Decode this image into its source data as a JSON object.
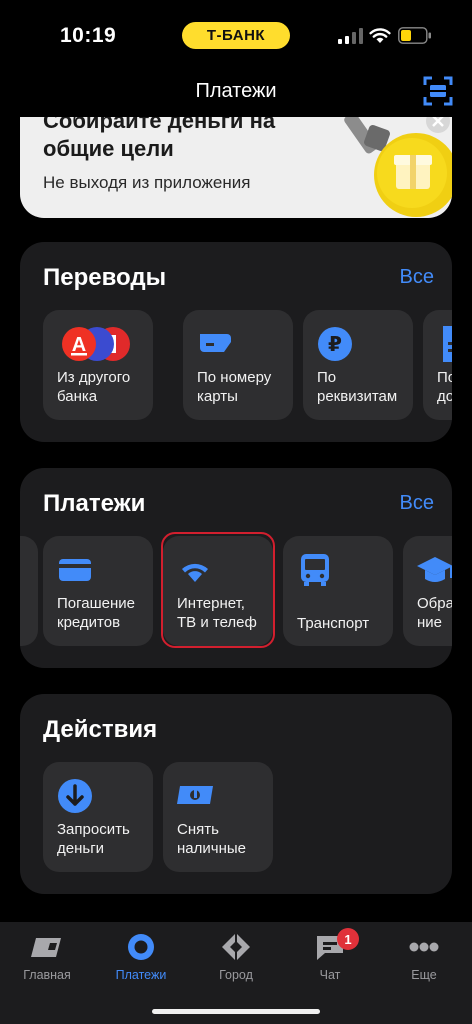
{
  "status_bar": {
    "time": "10:19",
    "bank_badge": "Т-БАНК"
  },
  "header": {
    "title": "Платежи"
  },
  "promo": {
    "title": "Собирайте деньги на общие цели",
    "subtitle": "Не выходя из приложения"
  },
  "transfers": {
    "title": "Переводы",
    "all_label": "Все",
    "items": [
      {
        "label": "Из другого\nбанка",
        "icon": "bank-logos-icon"
      },
      {
        "label": "По номеру\nкарты",
        "icon": "card-icon"
      },
      {
        "label": "По\nреквизитам",
        "icon": "ruble-icon"
      },
      {
        "label": "По но\nдогово",
        "icon": "document-icon"
      }
    ]
  },
  "payments": {
    "title": "Платежи",
    "all_label": "Все",
    "items": [
      {
        "label": "Погашение\nкредитов",
        "icon": "credit-card-icon"
      },
      {
        "label": "Интернет,\nТВ и телеф",
        "icon": "wifi-icon"
      },
      {
        "label": "Транспорт",
        "icon": "bus-icon"
      },
      {
        "label": "Обра\nние",
        "icon": "graduation-cap-icon"
      }
    ]
  },
  "actions": {
    "title": "Действия",
    "items": [
      {
        "label": "Запросить\nденьги",
        "icon": "arrow-down-icon"
      },
      {
        "label": "Снять\nналичные",
        "icon": "cash-icon"
      }
    ]
  },
  "tabbar": {
    "items": [
      {
        "label": "Главная",
        "icon": "home-card-icon"
      },
      {
        "label": "Платежи",
        "icon": "payments-circle-icon",
        "active": true
      },
      {
        "label": "Город",
        "icon": "city-diamond-icon"
      },
      {
        "label": "Чат",
        "icon": "chat-icon",
        "badge": "1"
      },
      {
        "label": "Еще",
        "icon": "more-dots-icon"
      }
    ]
  },
  "colors": {
    "accent": "#428bf9",
    "brand_yellow": "#ffdd2d",
    "highlight_red": "#d21f2e",
    "badge_red": "#e0313a"
  }
}
